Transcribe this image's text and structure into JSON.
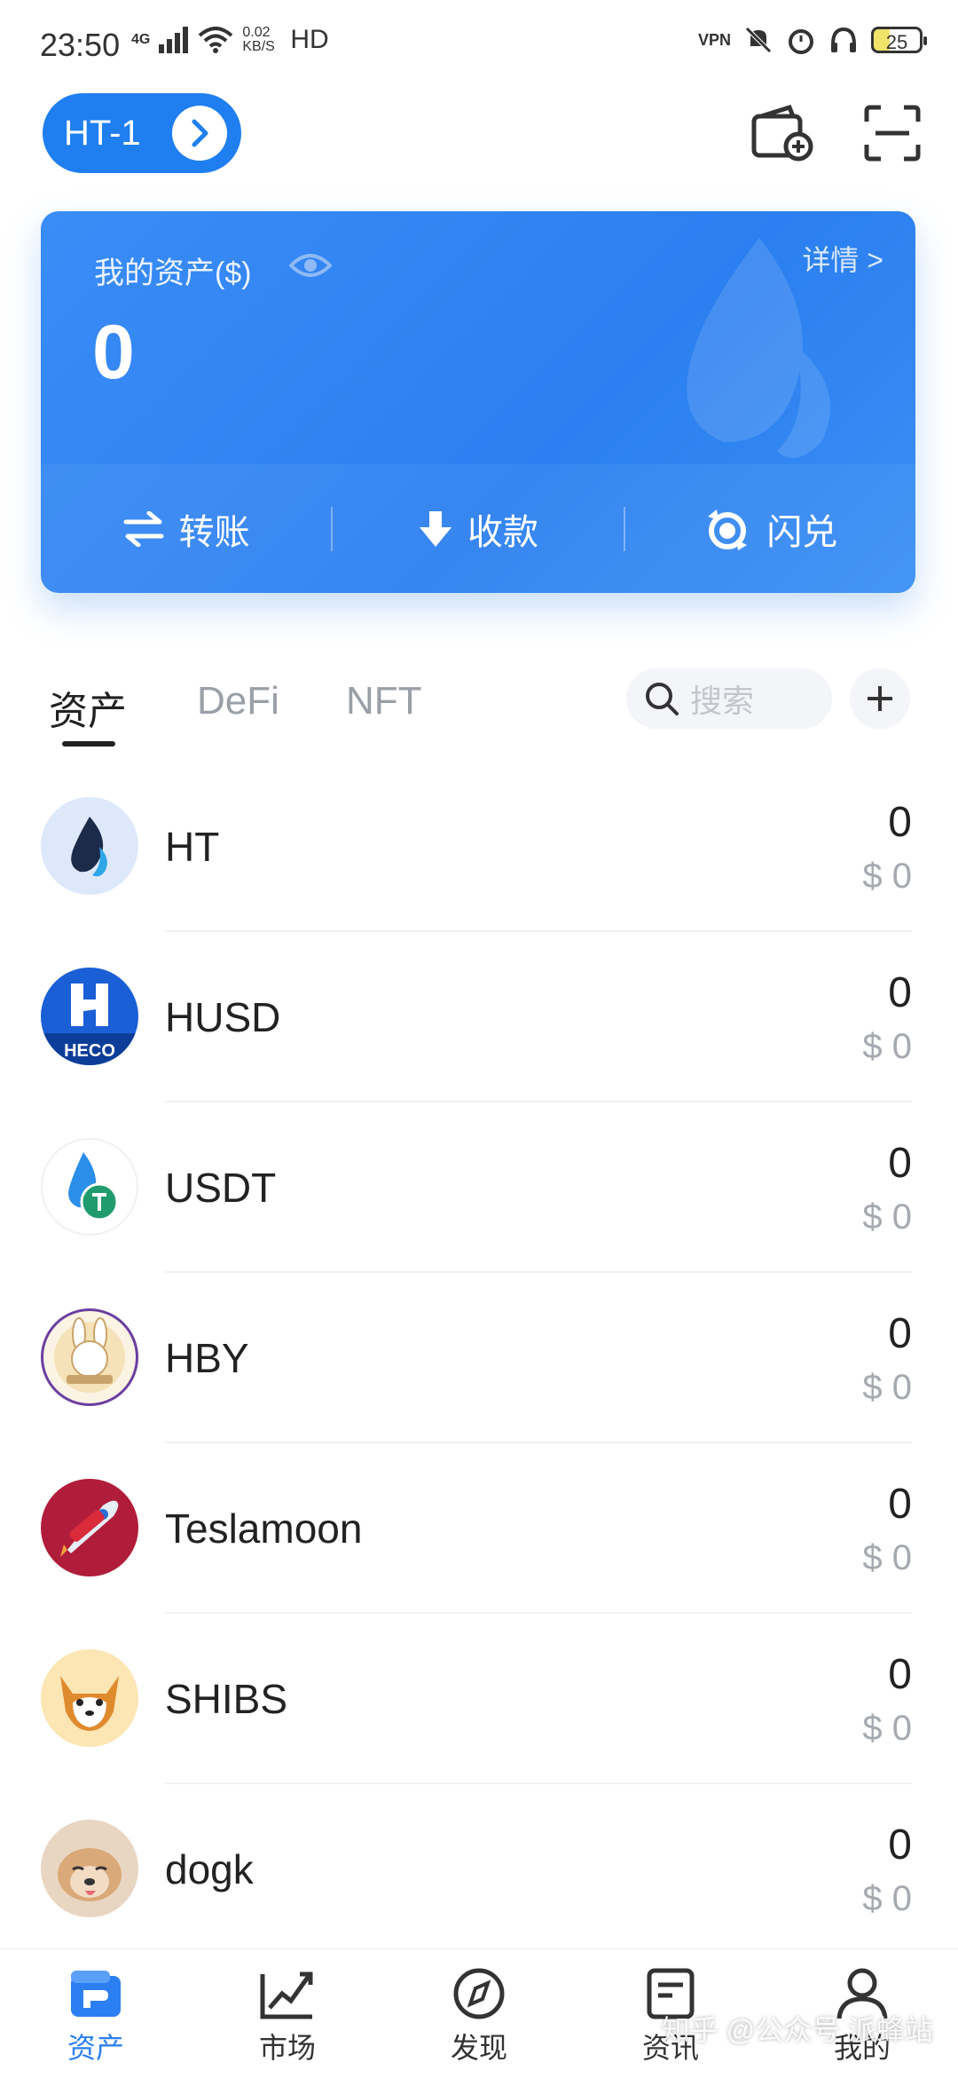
{
  "status_bar": {
    "time": "23:50",
    "network": "4G",
    "speed": "0.02 KB/S",
    "hd": "HD",
    "vpn": "VPN",
    "battery": "25"
  },
  "header": {
    "network_label": "HT-1"
  },
  "asset_card": {
    "title": "我的资产($)",
    "detail": "详情 >",
    "value": "0",
    "actions": [
      {
        "label": "转账",
        "icon": "transfer-icon"
      },
      {
        "label": "收款",
        "icon": "receive-icon"
      },
      {
        "label": "闪兑",
        "icon": "swap-icon"
      }
    ]
  },
  "tabs": [
    {
      "label": "资产",
      "active": true
    },
    {
      "label": "DeFi",
      "active": false
    },
    {
      "label": "NFT",
      "active": false
    }
  ],
  "search": {
    "placeholder": "搜索"
  },
  "tokens": [
    {
      "symbol": "HT",
      "amount": "0",
      "fiat": "$ 0"
    },
    {
      "symbol": "HUSD",
      "amount": "0",
      "fiat": "$ 0"
    },
    {
      "symbol": "USDT",
      "amount": "0",
      "fiat": "$ 0"
    },
    {
      "symbol": "HBY",
      "amount": "0",
      "fiat": "$ 0"
    },
    {
      "symbol": "Teslamoon",
      "amount": "0",
      "fiat": "$ 0"
    },
    {
      "symbol": "SHIBS",
      "amount": "0",
      "fiat": "$ 0"
    },
    {
      "symbol": "dogk",
      "amount": "0",
      "fiat": "$ 0"
    }
  ],
  "bottom_nav": [
    {
      "label": "资产",
      "icon": "wallet-icon",
      "active": true
    },
    {
      "label": "市场",
      "icon": "market-chart-icon",
      "active": false
    },
    {
      "label": "发现",
      "icon": "compass-icon",
      "active": false
    },
    {
      "label": "资讯",
      "icon": "news-icon",
      "active": false
    },
    {
      "label": "我的",
      "icon": "profile-icon",
      "active": false
    }
  ],
  "watermark": "知乎 @公众号 派蜂站",
  "colors": {
    "accent": "#2b7ff0",
    "card": "#3a8cf7"
  }
}
